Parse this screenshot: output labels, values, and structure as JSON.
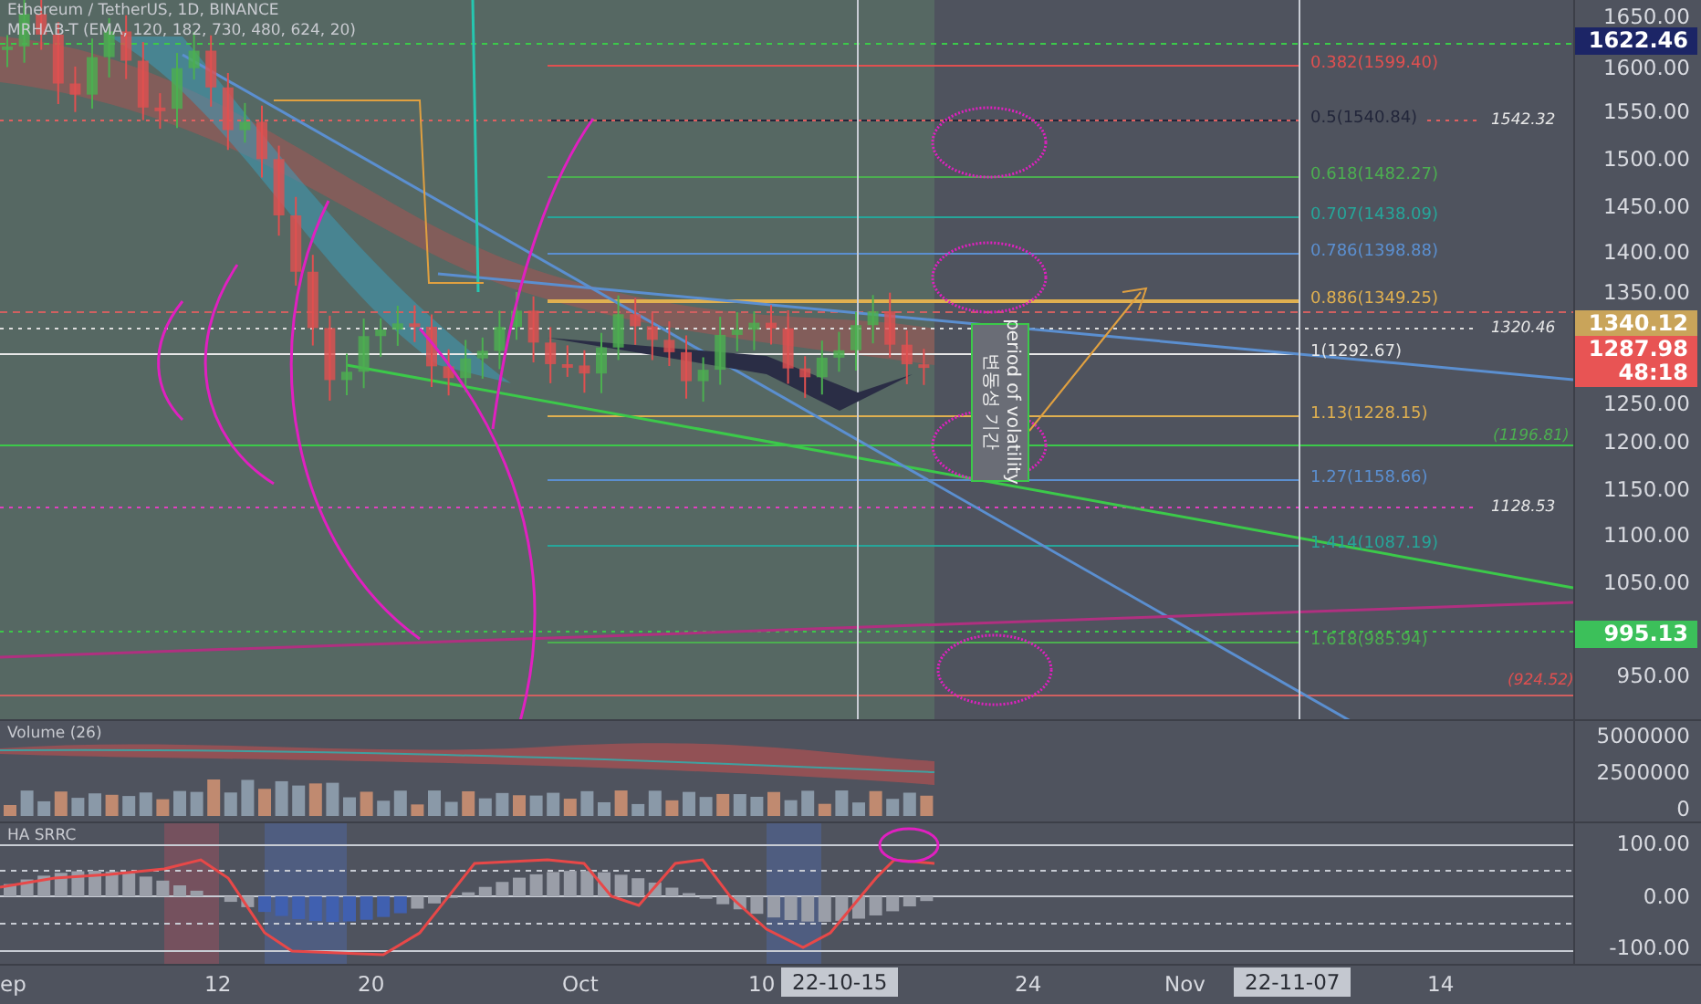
{
  "header": {
    "symbol": "Ethereum / TetherUS, 1D, BINANCE",
    "indicator": "MRHAB-T (EMA, 120, 182, 730, 480, 624, 20)"
  },
  "price_axis": {
    "ticks": [
      "1650.00",
      "1600.00",
      "1550.00",
      "1500.00",
      "1450.00",
      "1400.00",
      "1350.00",
      "1250.00",
      "1200.00",
      "1150.00",
      "1100.00",
      "1050.00",
      "950.00"
    ]
  },
  "price_tags": [
    {
      "lines": [
        "1622.46"
      ],
      "color": "#1c2566"
    },
    {
      "lines": [
        "1340.12"
      ],
      "color": "#c9a45a"
    },
    {
      "lines": [
        "1287.98",
        "48:18"
      ],
      "color": "#e85454"
    },
    {
      "lines": [
        "995.13"
      ],
      "color": "#3cc05a"
    }
  ],
  "fib_levels": [
    {
      "label": "0.382(1599.40)",
      "color": "#e05050"
    },
    {
      "label": "0.5(1540.84)",
      "color": "#22263a"
    },
    {
      "label": "0.618(1482.27)",
      "color": "#4caf50"
    },
    {
      "label": "0.707(1438.09)",
      "color": "#26a69a"
    },
    {
      "label": "0.786(1398.88)",
      "color": "#5b8fd0"
    },
    {
      "label": "0.886(1349.25)",
      "color": "#e0b050"
    },
    {
      "label": "1(1292.67)",
      "color": "#e8e8e8"
    },
    {
      "label": "1.13(1228.15)",
      "color": "#e0b050"
    },
    {
      "label": "1.27(1158.66)",
      "color": "#5b8fd0"
    },
    {
      "label": "1.414(1087.19)",
      "color": "#26a69a"
    },
    {
      "label": "1.618(985.94)",
      "color": "#4caf50"
    }
  ],
  "line_labels": [
    {
      "text": "1542.32",
      "color": "#e8e8e8"
    },
    {
      "text": "1320.46",
      "color": "#e8e8e8"
    },
    {
      "text": "(1196.81)",
      "color": "#4caf50"
    },
    {
      "text": "1128.53",
      "color": "#e8e8e8"
    },
    {
      "text": "(924.52)",
      "color": "#e05050"
    }
  ],
  "annotation": {
    "lines": [
      "period of volatility",
      "변동성 기간"
    ]
  },
  "volume": {
    "title": "Volume (26)",
    "ticks": [
      "5000000",
      "2500000",
      "0"
    ]
  },
  "oscillator": {
    "title": "HA SRRC",
    "ticks": [
      "100.00",
      "0.00",
      "-100.00"
    ]
  },
  "time_axis": {
    "labels": [
      "ep",
      "12",
      "20",
      "Oct",
      "10",
      "24",
      "Nov",
      "14"
    ],
    "tags": [
      "22-10-15",
      "22-11-07"
    ]
  }
}
